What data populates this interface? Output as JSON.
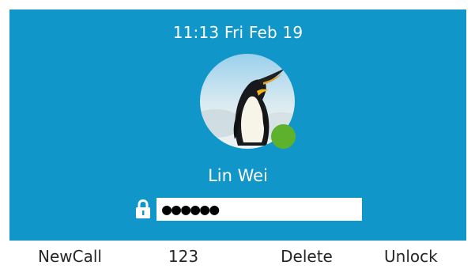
{
  "status_bar": {
    "clock": "11:13 Fri Feb 19"
  },
  "account": {
    "name": "Lin Wei",
    "status_color": "#5eb12d",
    "avatar_subject": "penguin-photo"
  },
  "password": {
    "value": "●●●●●●",
    "icon": "lock-icon"
  },
  "softkeys": [
    {
      "label": "NewCall"
    },
    {
      "label": "123"
    },
    {
      "label": "Delete"
    },
    {
      "label": "Unlock"
    }
  ],
  "colors": {
    "background": "#1196c9",
    "softkey_bar": "#ffffff",
    "text_light": "#ffffff",
    "text_dark": "#262626"
  }
}
